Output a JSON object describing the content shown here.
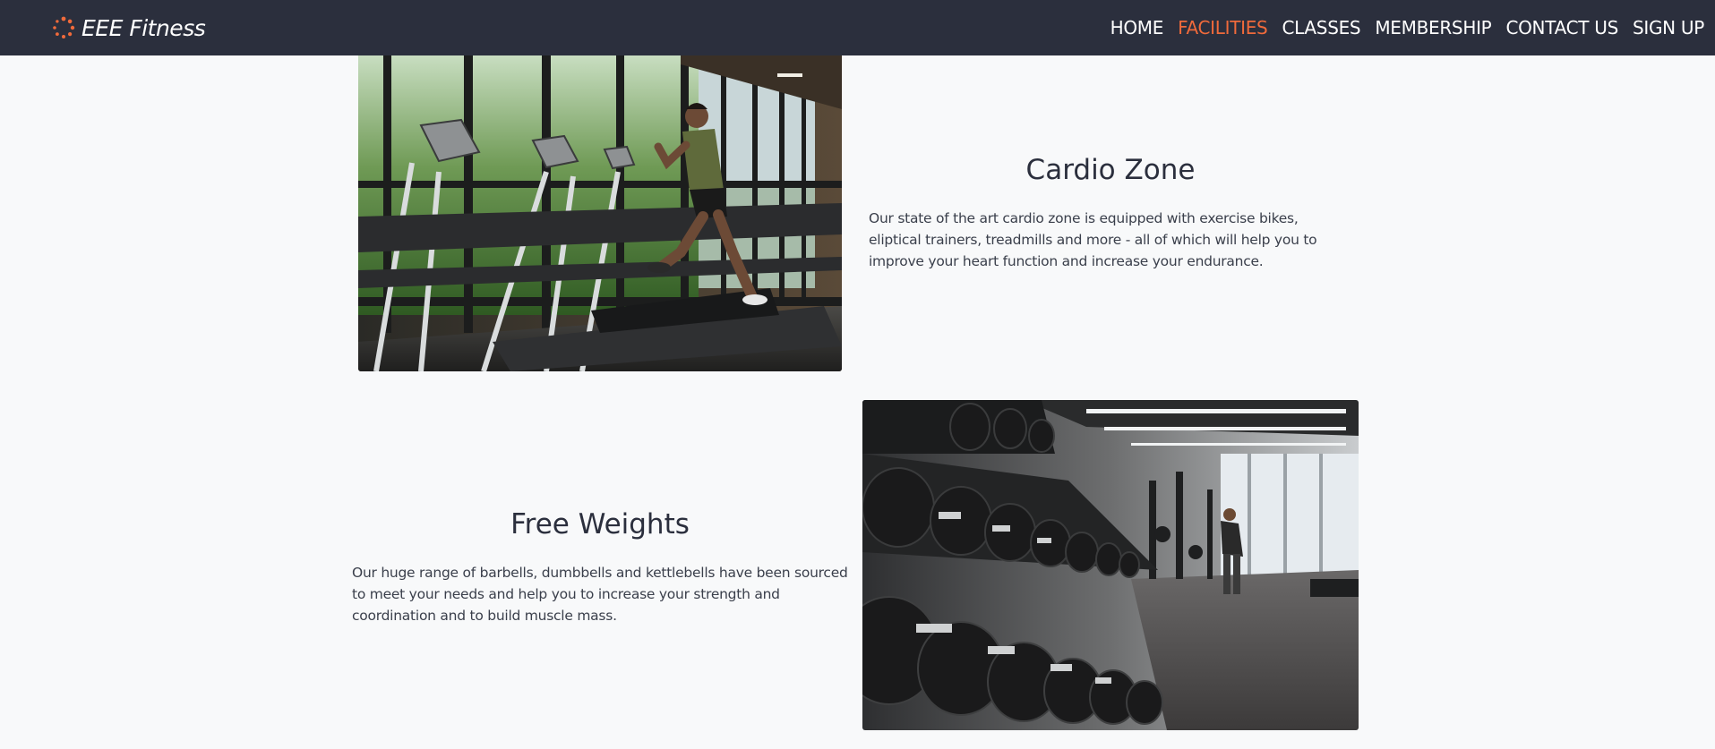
{
  "brand": {
    "name": "EEE Fitness",
    "icon": "spinner-dots-icon",
    "accent_color": "#f06a3b"
  },
  "nav": {
    "background_color": "#2b2f3d",
    "items": [
      {
        "label": "HOME",
        "active": false
      },
      {
        "label": "FACILITIES",
        "active": true
      },
      {
        "label": "CLASSES",
        "active": false
      },
      {
        "label": "MEMBERSHIP",
        "active": false
      },
      {
        "label": "CONTACT US",
        "active": false
      },
      {
        "label": "SIGN UP",
        "active": false
      }
    ]
  },
  "facilities": [
    {
      "title": "Cardio Zone",
      "description": "Our state of the art cardio zone is equipped with exercise bikes, eliptical trainers, treadmills and more - all of which will help you to improve your heart function and increase your endurance.",
      "image": "treadmills-photo"
    },
    {
      "title": "Free Weights",
      "description": "Our huge range of barbells, dumbbells and kettlebells have been sourced to meet your needs and help you to increase your strength and coordination and to build muscle mass.",
      "image": "dumbbell-rack-photo"
    }
  ]
}
